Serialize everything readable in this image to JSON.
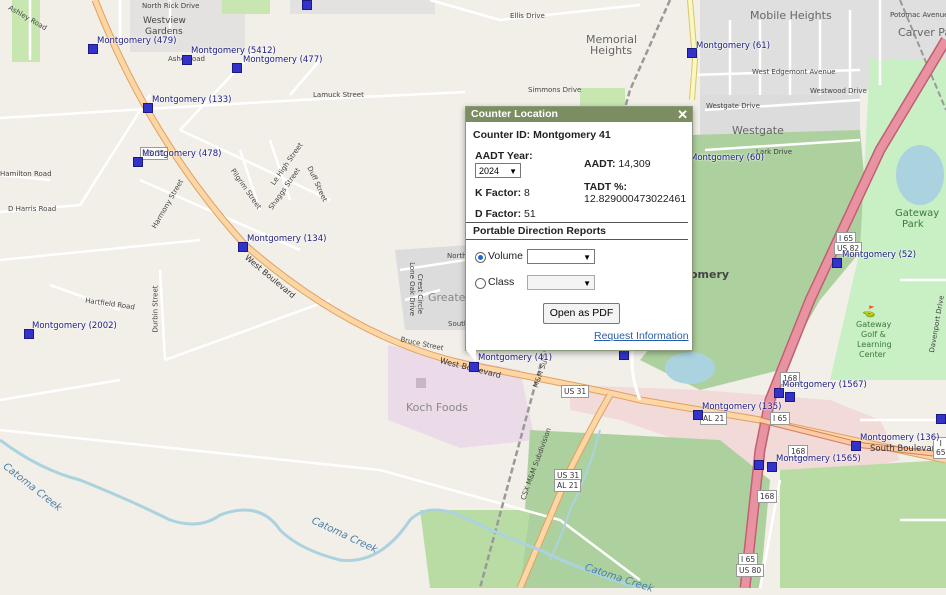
{
  "popup": {
    "header": "Counter Location",
    "close": "✕",
    "counter_id": "Counter ID: Montgomery 41",
    "aadt_year_label": "AADT Year:",
    "aadt_year_value": "2024",
    "aadt_label": "AADT:",
    "aadt_value": "14,309",
    "k_factor_label": "K Factor:",
    "k_factor_value": "8",
    "tadt_label": "TADT %:",
    "tadt_value": "12.829000473022461",
    "d_factor_label": "D Factor:",
    "d_factor_value": "51",
    "section_title": "Portable Direction Reports",
    "volume_label": "Volume",
    "class_label": "Class",
    "volume_selected": true,
    "open_pdf_label": "Open as PDF",
    "request_link": "Request Information"
  },
  "counters": [
    {
      "label": "Montgomery (479)"
    },
    {
      "label": "Montgomery (5412)"
    },
    {
      "label": "Montgomery (477)"
    },
    {
      "label": "Montgomery (133)"
    },
    {
      "label": "Montgomery (478)"
    },
    {
      "label": "Montgomery (134)"
    },
    {
      "label": "Montgomery (2002)"
    },
    {
      "label": "Montgomery (41)"
    },
    {
      "label": "Montgomery (61)"
    },
    {
      "label": "Montgomery (60)"
    },
    {
      "label": "Montgomery (52)"
    },
    {
      "label": "Montgomery (1567)"
    },
    {
      "label": "Montgomery (135)"
    },
    {
      "label": "Montgomery (136)"
    },
    {
      "label": "Montgomery (1565)"
    }
  ],
  "map_labels": {
    "westview": "Westview",
    "gardens": "Gardens",
    "north_rick": "North Rick Drive",
    "ellis": "Ellis Drive",
    "memorial": "Memorial",
    "heights": "Heights",
    "mobile_heights": "Mobile Heights",
    "carver_park": "Carver Park",
    "potomac": "Potomac Avenue",
    "west_edgemont": "West Edgemont Avenue",
    "westgate_drive": "Westgate Drive",
    "westgate": "Westgate",
    "westwood": "Westwood Drive",
    "lark": "Lark Drive",
    "simmons": "Simmons Drive",
    "lamuck": "Lamuck Street",
    "ashley": "Ashley Road",
    "ashe": "Ashe Road",
    "gateway_park": "Gateway",
    "gateway_park2": "Park",
    "golf1": "Gateway",
    "golf2": "Golf &",
    "golf3": "Learning",
    "golf4": "Center",
    "koch": "Koch Foods",
    "greater_w": "Greater W",
    "hartfield": "Hartfield Road",
    "durbin": "Durbin Street",
    "harmony": "Harmony Street",
    "pilgrim": "Pilgrim Street",
    "le_high": "Le High Street",
    "shaggs": "Shaggs Street",
    "duff": "Duff Street",
    "hamilton": "Hamilton Road",
    "d_harris": "D Harris Road",
    "west_boulevard": "West Boulevard",
    "west_boulevard2": "West Boulevard",
    "south_boulevard": "South Boulevard",
    "catoma1": "Catoma Creek",
    "catoma2": "Catoma Creek",
    "catoma3": "Catoma Creek",
    "csx": "CSX M&M Subdivision",
    "lone_oak": "Lone Oak Drive",
    "crest": "Crest Circle",
    "bruce": "Bruce Street",
    "north_s": "North S",
    "south_s": "South",
    "davenport": "Davenport Drive",
    "omery": "omery",
    "mm_sub": "M&M Su"
  },
  "shields": {
    "us31a": "US 31",
    "us31b": "US 31",
    "us31c": "US 31",
    "al21a": "AL 21",
    "al21b": "AL 21",
    "i65a": "I 65",
    "us82": "US 82",
    "i65b": "I 65",
    "i65c": "I 65",
    "us80": "US 80",
    "i65d": "I 65",
    "n168a": "168",
    "n168b": "168",
    "n168c": "168"
  },
  "colors": {
    "background": "#f2efe9",
    "residential": "#e0dfdf",
    "park": "#c8e6b0",
    "forest": "#add19e",
    "commercial": "#f2dad9",
    "industrial": "#ebdbe8",
    "primary_road": "#fcd6a4",
    "motorway": "#e892a2",
    "water": "#aad3df",
    "counter": "#3333cc",
    "popup_header": "#7d8d62"
  }
}
